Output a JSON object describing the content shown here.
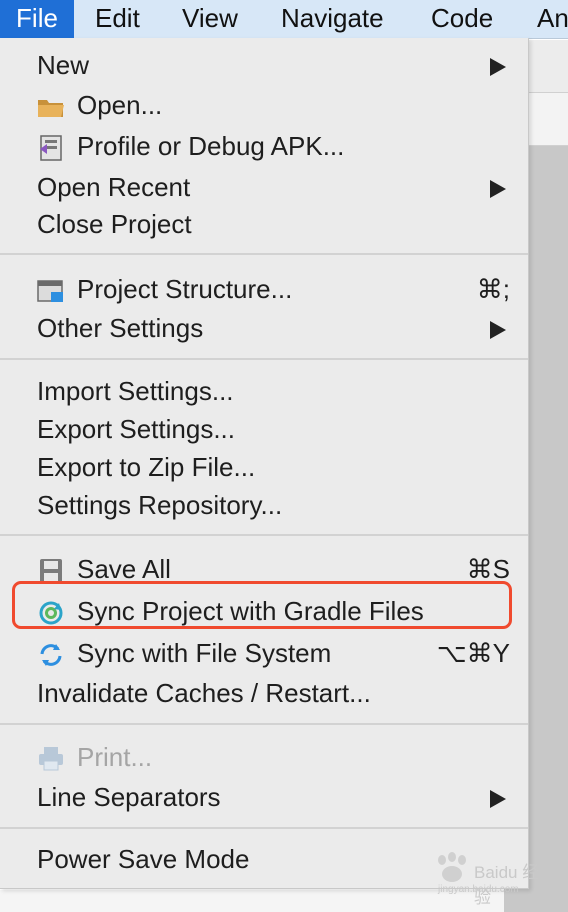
{
  "menubar": {
    "items": [
      {
        "label": "File",
        "active": true
      },
      {
        "label": "Edit"
      },
      {
        "label": "View"
      },
      {
        "label": "Navigate"
      },
      {
        "label": "Code"
      },
      {
        "label": "An"
      }
    ]
  },
  "file_menu": {
    "groups": [
      [
        {
          "label": "New",
          "submenu": true
        },
        {
          "label": "Open...",
          "icon": "folder-icon"
        },
        {
          "label": "Profile or Debug APK...",
          "icon": "apk-debug-icon"
        },
        {
          "label": "Open Recent",
          "submenu": true
        },
        {
          "label": "Close Project"
        }
      ],
      [
        {
          "label": "Project Structure...",
          "icon": "project-structure-icon",
          "shortcut": "⌘;"
        },
        {
          "label": "Other Settings",
          "submenu": true
        }
      ],
      [
        {
          "label": "Import Settings..."
        },
        {
          "label": "Export Settings..."
        },
        {
          "label": "Export to Zip File..."
        },
        {
          "label": "Settings Repository..."
        }
      ],
      [
        {
          "label": "Save All",
          "icon": "save-icon",
          "shortcut": "⌘S"
        },
        {
          "label": "Sync Project with Gradle Files",
          "icon": "gradle-sync-icon",
          "highlighted": true
        },
        {
          "label": "Sync with File System",
          "icon": "refresh-icon",
          "shortcut": "⌥⌘Y"
        },
        {
          "label": "Invalidate Caches / Restart..."
        }
      ],
      [
        {
          "label": "Print...",
          "icon": "printer-icon",
          "disabled": true
        },
        {
          "label": "Line Separators",
          "submenu": true
        }
      ],
      [
        {
          "label": "Power Save Mode"
        }
      ]
    ]
  },
  "highlight_color": "#f04a2e",
  "accent_color": "#1f6fd6",
  "watermark": {
    "text": "Baidu 经验",
    "sub": "jingyan.baidu.com"
  }
}
